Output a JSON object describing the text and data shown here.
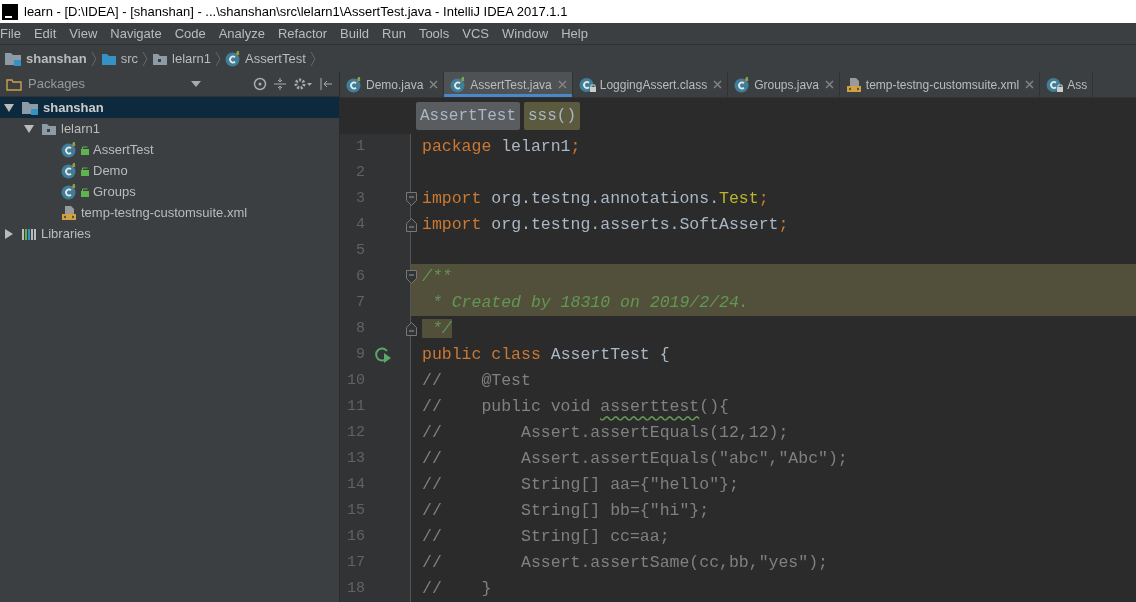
{
  "window": {
    "title": "learn - [D:\\IDEA] - [shanshan] - ...\\shanshan\\src\\lelarn1\\AssertTest.java - IntelliJ IDEA 2017.1.1"
  },
  "menu": [
    "File",
    "Edit",
    "View",
    "Navigate",
    "Code",
    "Analyze",
    "Refactor",
    "Build",
    "Run",
    "Tools",
    "VCS",
    "Window",
    "Help"
  ],
  "breadcrumbs": [
    {
      "label": "shanshan",
      "kind": "project"
    },
    {
      "label": "src",
      "kind": "folder"
    },
    {
      "label": "lelarn1",
      "kind": "package"
    },
    {
      "label": "AssertTest",
      "kind": "class"
    }
  ],
  "project_panel": {
    "title": "Packages",
    "tree": [
      {
        "label": "shanshan",
        "kind": "project",
        "expanded": true,
        "selected": true,
        "children": [
          {
            "label": "lelarn1",
            "kind": "package",
            "expanded": true,
            "selected": false,
            "children": [
              {
                "label": "AssertTest",
                "kind": "class",
                "selected": false
              },
              {
                "label": "Demo",
                "kind": "class",
                "selected": false
              },
              {
                "label": "Groups",
                "kind": "class",
                "selected": false
              },
              {
                "label": "temp-testng-customsuite.xml",
                "kind": "xml",
                "selected": false
              }
            ]
          }
        ]
      },
      {
        "label": "Libraries",
        "kind": "libraries",
        "expanded": false,
        "selected": false
      }
    ]
  },
  "editor": {
    "tabs": [
      {
        "label": "Demo.java",
        "kind": "class",
        "selected": false,
        "closable": true
      },
      {
        "label": "AssertTest.java",
        "kind": "class",
        "selected": true,
        "closable": true
      },
      {
        "label": "LoggingAssert.class",
        "kind": "class-locked",
        "selected": false,
        "closable": true
      },
      {
        "label": "Groups.java",
        "kind": "class",
        "selected": false,
        "closable": true
      },
      {
        "label": "temp-testng-customsuite.xml",
        "kind": "xml",
        "selected": false,
        "closable": true
      },
      {
        "label": "Ass",
        "kind": "class-locked",
        "selected": false,
        "closable": false
      }
    ],
    "structure_crumbs": [
      {
        "label": "AssertTest",
        "kind": "class"
      },
      {
        "label": "sss()",
        "kind": "method"
      }
    ],
    "lines": [
      {
        "number": "1",
        "tokens": [
          {
            "kind": "keyword",
            "text": "package"
          },
          {
            "kind": "plain",
            "text": " lelarn1"
          },
          {
            "kind": "keyword",
            "text": ";"
          }
        ]
      },
      {
        "number": "2"
      },
      {
        "number": "3",
        "fold_start": true,
        "tokens": [
          {
            "kind": "keyword",
            "text": "import"
          },
          {
            "kind": "plain",
            "text": " org.testng.annotations."
          },
          {
            "kind": "annotation",
            "text": "Test"
          },
          {
            "kind": "keyword",
            "text": ";"
          }
        ]
      },
      {
        "number": "4",
        "fold_end": true,
        "tokens": [
          {
            "kind": "keyword",
            "text": "import"
          },
          {
            "kind": "plain",
            "text": " org.testng.asserts.SoftAssert"
          },
          {
            "kind": "keyword",
            "text": ";"
          }
        ]
      },
      {
        "number": "5"
      },
      {
        "number": "6",
        "fold_start": true,
        "highlighted": true,
        "tokens": [
          {
            "kind": "doc",
            "text": "/**"
          }
        ]
      },
      {
        "number": "7",
        "highlighted": true,
        "tokens": [
          {
            "kind": "doc",
            "text": " * Created by 18310 on 2019/2/24."
          }
        ]
      },
      {
        "number": "8",
        "fold_end": true,
        "tokens": [
          {
            "kind": "doc",
            "text": " */",
            "highlighted": true
          }
        ]
      },
      {
        "number": "9",
        "run_marker": true,
        "tokens": [
          {
            "kind": "keyword",
            "text": "public class "
          },
          {
            "kind": "plain",
            "text": "AssertTest {"
          }
        ]
      },
      {
        "number": "10",
        "tokens": [
          {
            "kind": "comment",
            "text": "//    @Test"
          }
        ]
      },
      {
        "number": "11",
        "tokens": [
          {
            "kind": "comment",
            "text": "//    public void "
          },
          {
            "kind": "comment",
            "text": "asserttest",
            "warning": true
          },
          {
            "kind": "comment",
            "text": "(){"
          }
        ]
      },
      {
        "number": "12",
        "tokens": [
          {
            "kind": "comment",
            "text": "//        Assert.assertEquals(12,12);"
          }
        ]
      },
      {
        "number": "13",
        "tokens": [
          {
            "kind": "comment",
            "text": "//        Assert.assertEquals(\"abc\",\"Abc\");"
          }
        ]
      },
      {
        "number": "14",
        "tokens": [
          {
            "kind": "comment",
            "text": "//        String[] aa={\"hello\"};"
          }
        ]
      },
      {
        "number": "15",
        "tokens": [
          {
            "kind": "comment",
            "text": "//        String[] bb={\"hi\"};"
          }
        ]
      },
      {
        "number": "16",
        "tokens": [
          {
            "kind": "comment",
            "text": "//        String[] cc=aa;"
          }
        ]
      },
      {
        "number": "17",
        "tokens": [
          {
            "kind": "comment",
            "text": "//        Assert.assertSame(cc,bb,\"yes\");"
          }
        ]
      },
      {
        "number": "18",
        "tokens": [
          {
            "kind": "comment",
            "text": "//    }"
          }
        ]
      }
    ]
  }
}
